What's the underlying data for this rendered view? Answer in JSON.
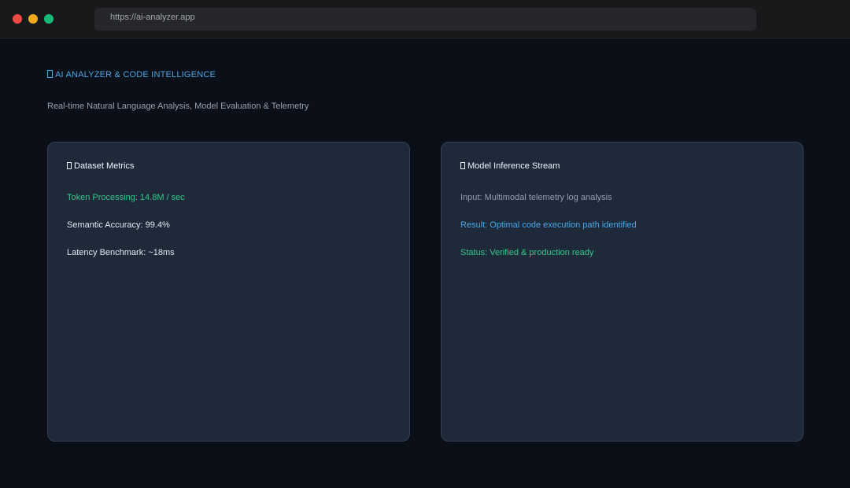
{
  "browser": {
    "url": "https://ai-analyzer.app",
    "traffic_lights": {
      "close_color": "#ee4a45",
      "minimize_color": "#f1a91c",
      "maximize_color": "#1bb978"
    }
  },
  "header": {
    "title": "AI ANALYZER & CODE INTELLIGENCE",
    "title_icon": "box-glyph-icon",
    "subtitle": "Real-time Natural Language Analysis, Model Evaluation & Telemetry"
  },
  "panels": {
    "dataset": {
      "title": "Dataset Metrics",
      "icon": "box-glyph-icon",
      "lines": [
        "Token Processing: 14.8M / sec",
        "Semantic Accuracy: 99.4%",
        "Latency Benchmark: ~18ms"
      ]
    },
    "inference": {
      "title": "Model Inference Stream",
      "icon": "box-glyph-icon",
      "lines": [
        "Input: Multimodal telemetry log analysis",
        "Result: Optimal code execution path identified",
        "Status: Verified & production ready"
      ]
    }
  },
  "colors": {
    "accent_blue": "#4aa8e8",
    "accent_green": "#34c88a",
    "panel_bg": "#1e293a",
    "page_bg": "#0b0f17"
  }
}
